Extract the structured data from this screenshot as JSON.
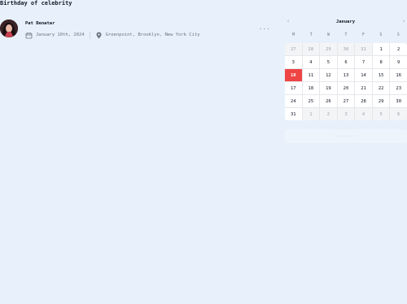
{
  "page": {
    "title": "Birthday of celebrity"
  },
  "event": {
    "name": "Pat Benatar",
    "date": "January 10th, 2024",
    "location": "Greenpoint, Brooklyn, New York City",
    "more_label": "..."
  },
  "icons": {
    "date": "calendar-icon",
    "location": "map-pin-icon",
    "prev": "chevron-left-icon",
    "next": "chevron-right-icon"
  },
  "calendar": {
    "month": "January",
    "prev_label": "‹",
    "next_label": "›",
    "weekdays": [
      "M",
      "T",
      "W",
      "T",
      "F",
      "S",
      "S"
    ],
    "days": [
      {
        "label": "27",
        "muted": true
      },
      {
        "label": "28",
        "muted": true
      },
      {
        "label": "29",
        "muted": true
      },
      {
        "label": "30",
        "muted": true
      },
      {
        "label": "31",
        "muted": true
      },
      {
        "label": "1"
      },
      {
        "label": "2"
      },
      {
        "label": "3"
      },
      {
        "label": "4"
      },
      {
        "label": "5"
      },
      {
        "label": "6"
      },
      {
        "label": "7"
      },
      {
        "label": "8"
      },
      {
        "label": "9"
      },
      {
        "label": "10",
        "selected": true
      },
      {
        "label": "11"
      },
      {
        "label": "12"
      },
      {
        "label": "13"
      },
      {
        "label": "14"
      },
      {
        "label": "15"
      },
      {
        "label": "16"
      },
      {
        "label": "17"
      },
      {
        "label": "18"
      },
      {
        "label": "19"
      },
      {
        "label": "20"
      },
      {
        "label": "21"
      },
      {
        "label": "22"
      },
      {
        "label": "23"
      },
      {
        "label": "24"
      },
      {
        "label": "25"
      },
      {
        "label": "26"
      },
      {
        "label": "27"
      },
      {
        "label": "28"
      },
      {
        "label": "29"
      },
      {
        "label": "30"
      },
      {
        "label": "31"
      },
      {
        "label": "1",
        "muted": true
      },
      {
        "label": "2",
        "muted": true
      },
      {
        "label": "3",
        "muted": true
      },
      {
        "label": "4",
        "muted": true
      },
      {
        "label": "5",
        "muted": true
      },
      {
        "label": "6",
        "muted": true
      }
    ],
    "add_event_label": "Add event"
  },
  "colors": {
    "background": "#e8f1fb",
    "selected_day": "#ef4444",
    "muted_day_bg": "#f3f4f6"
  }
}
